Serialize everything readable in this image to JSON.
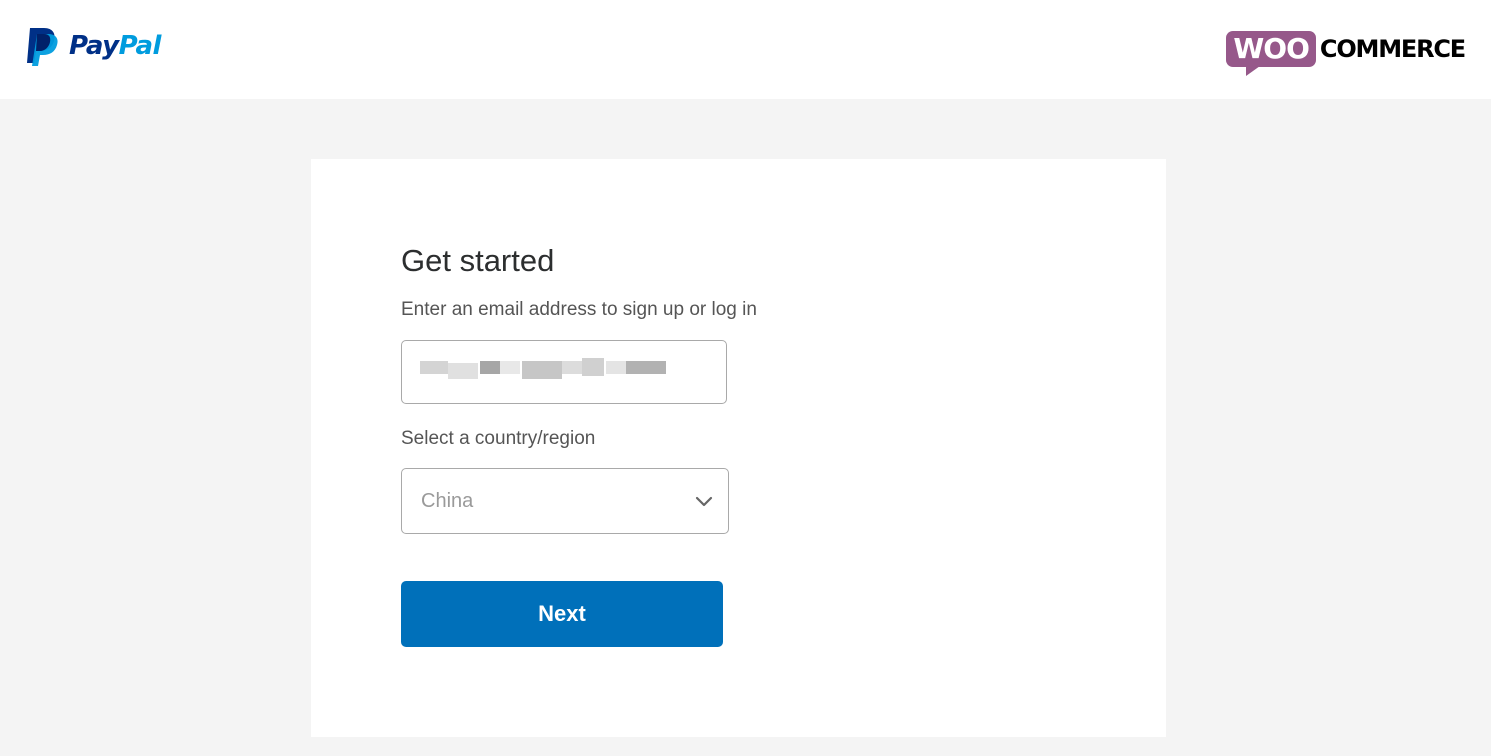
{
  "header": {
    "paypal_logo": {
      "pay": "Pay",
      "pal": "Pal"
    },
    "woo_logo": {
      "woo": "WOO",
      "commerce": "COMMERCE"
    }
  },
  "form": {
    "title": "Get started",
    "email_label": "Enter an email address to sign up or log in",
    "email_value_state": "redacted",
    "country_label": "Select a country/region",
    "country_value": "China",
    "next_label": "Next"
  },
  "icons": {
    "paypal": "paypal-p-icon",
    "dropdown": "chevron-down-icon"
  },
  "colors": {
    "paypal_dark": "#003087",
    "paypal_light": "#009cde",
    "woo_purple": "#96588a",
    "button_blue": "#0070ba",
    "page_background": "#f4f4f4"
  }
}
